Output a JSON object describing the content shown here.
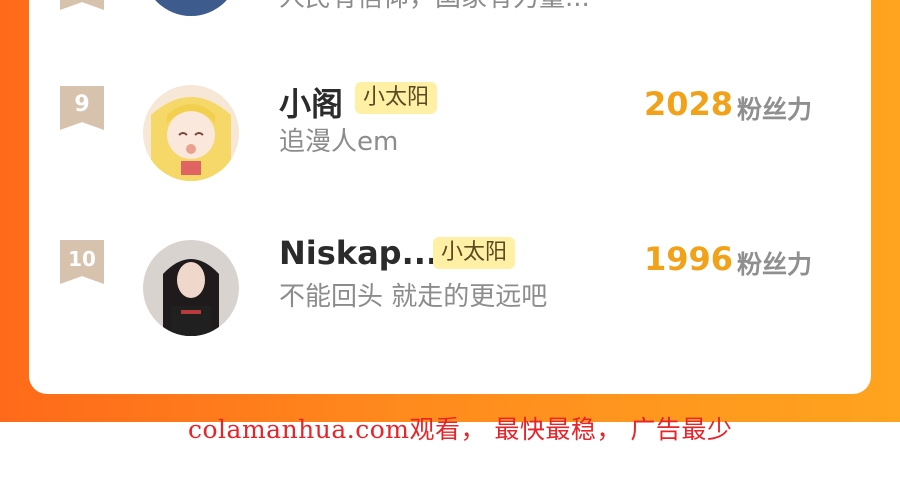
{
  "ranking": {
    "rows": [
      {
        "rank": "",
        "name": "",
        "badge": "",
        "subtitle": "人民有信仰，国家有力量...",
        "score": "",
        "unit": ""
      },
      {
        "rank": "9",
        "name": "小阁",
        "badge": "小太阳",
        "subtitle": "追漫人em",
        "score": "2028",
        "unit": "粉丝力"
      },
      {
        "rank": "10",
        "name": "Niskap...",
        "badge": "小太阳",
        "subtitle": "不能回头 就走的更远吧",
        "score": "1996",
        "unit": "粉丝力"
      }
    ]
  },
  "watermark": "colamanhua.com观看， 最快最稳， 广告最少",
  "colors": {
    "accent_orange": "#ff7a1c",
    "score_gold": "#f2a219",
    "badge_bg": "#fff0a5",
    "rank_badge": "#d7c3ad",
    "watermark_red": "#e8232a"
  }
}
